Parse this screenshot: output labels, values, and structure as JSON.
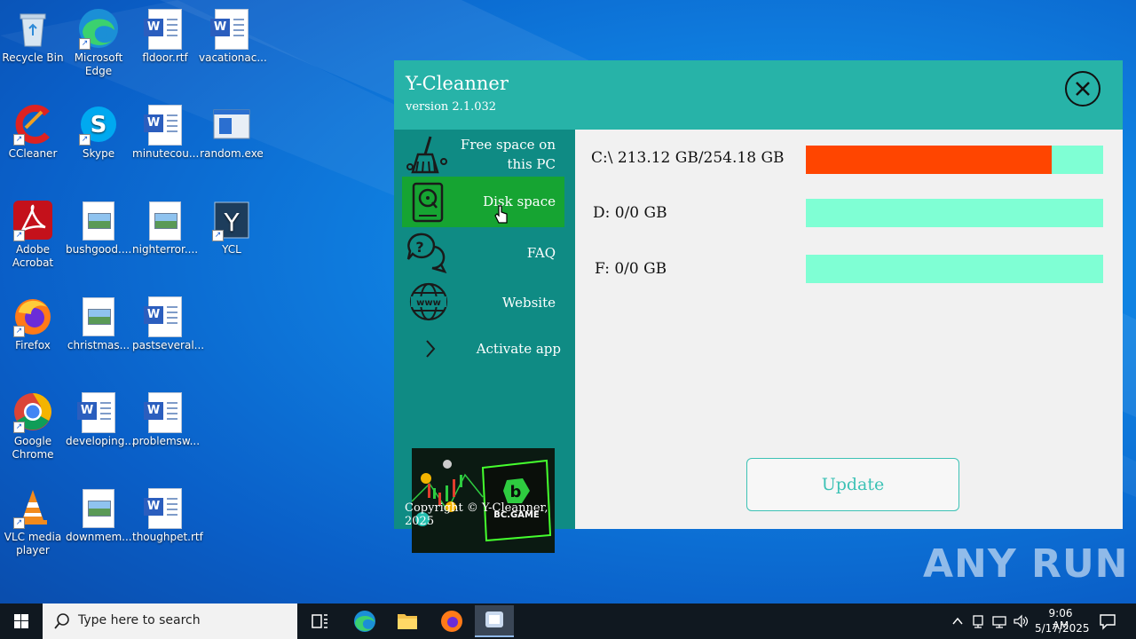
{
  "desktop": {
    "icons": [
      {
        "label": "Recycle Bin"
      },
      {
        "label": "Microsoft Edge"
      },
      {
        "label": "fldoor.rtf"
      },
      {
        "label": "vacationac..."
      },
      {
        "label": "CCleaner"
      },
      {
        "label": "Skype"
      },
      {
        "label": "minutecou..."
      },
      {
        "label": "random.exe"
      },
      {
        "label": "Adobe Acrobat"
      },
      {
        "label": "bushgood...."
      },
      {
        "label": "nighterror...."
      },
      {
        "label": "YCL"
      },
      {
        "label": "Firefox"
      },
      {
        "label": "christmas..."
      },
      {
        "label": "pastseveral..."
      },
      {
        "label": "Google Chrome"
      },
      {
        "label": "developing..."
      },
      {
        "label": "problemsw..."
      },
      {
        "label": "VLC media player"
      },
      {
        "label": "downmem..."
      },
      {
        "label": "thoughpet.rtf"
      }
    ]
  },
  "app": {
    "title": "Y-Cleanner",
    "version": "version 2.1.032",
    "nav": {
      "free_space": "Free space on this PC",
      "disk_space": "Disk space",
      "faq": "FAQ",
      "website": "Website",
      "activate": "Activate app"
    },
    "ad_text": "BC.GAME",
    "copyright": "Copyright © Y-Cleanner, 2025",
    "drives": [
      {
        "label": "C:\\ 213.12 GB/254.18 GB",
        "used_fraction": 0.828
      },
      {
        "label": "D: 0/0 GB",
        "used_fraction": 0
      },
      {
        "label": "F: 0/0 GB",
        "used_fraction": 0
      }
    ],
    "update_label": "Update"
  },
  "watermark": "ANY RUN",
  "taskbar": {
    "search_placeholder": "Type here to search",
    "time": "9:06 AM",
    "date": "5/17/2025"
  },
  "colors": {
    "header": "#27b3a8",
    "sidebar": "#0f8b84",
    "active_nav": "#16a432",
    "bar_track": "#7fffd4",
    "bar_fill": "#ff4500"
  }
}
